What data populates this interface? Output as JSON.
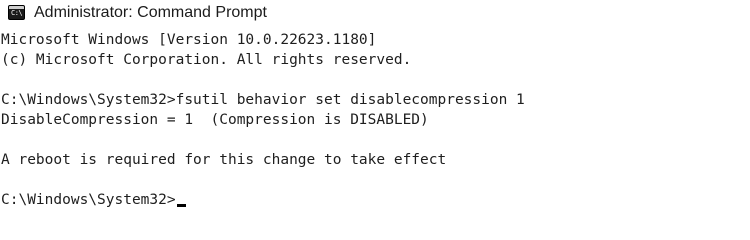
{
  "window": {
    "title": "Administrator: Command Prompt",
    "icon": "command-prompt-icon",
    "icon_glyph": "C:\\"
  },
  "console": {
    "lines": [
      "Microsoft Windows [Version 10.0.22623.1180]",
      "(c) Microsoft Corporation. All rights reserved.",
      "",
      "C:\\Windows\\System32>fsutil behavior set disablecompression 1",
      "DisableCompression = 1  (Compression is DISABLED)",
      "",
      "A reboot is required for this change to take effect",
      "",
      "C:\\Windows\\System32>"
    ]
  }
}
